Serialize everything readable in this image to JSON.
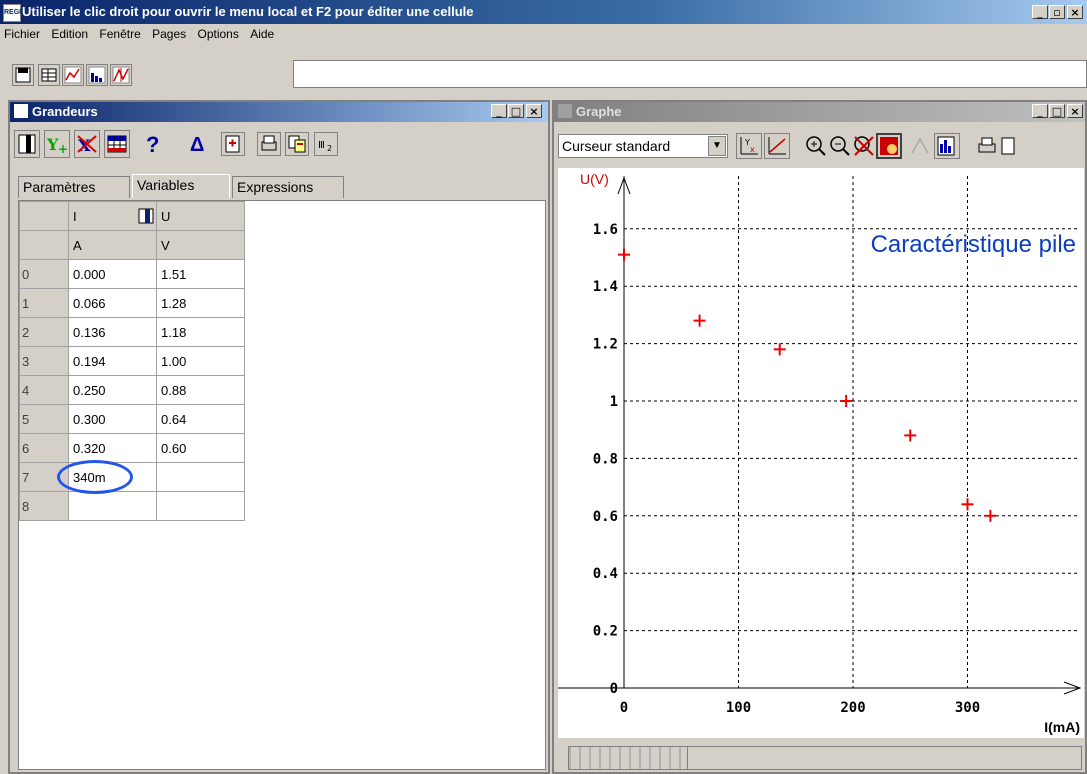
{
  "window": {
    "title": "Utiliser le clic droit pour ouvrir le menu local et F2 pour éditer une cellule",
    "app_icon_text": "REGR",
    "controls": [
      "_",
      "▫",
      "×"
    ]
  },
  "menu": [
    "Fichier",
    "Edition",
    "Fenêtre",
    "Pages",
    "Options",
    "Aide"
  ],
  "grandeurs": {
    "title": "Grandeurs",
    "tabs": [
      "Paramètres",
      "Variables",
      "Expressions"
    ],
    "active_tab": "Variables",
    "help_label": "?",
    "delta_label": "Δ",
    "columns": [
      {
        "name": "I",
        "unit": "A"
      },
      {
        "name": "U",
        "unit": "V"
      }
    ],
    "rows": [
      {
        "idx": "0",
        "I": "0.000",
        "U": "1.51"
      },
      {
        "idx": "1",
        "I": "0.066",
        "U": "1.28"
      },
      {
        "idx": "2",
        "I": "0.136",
        "U": "1.18"
      },
      {
        "idx": "3",
        "I": "0.194",
        "U": "1.00"
      },
      {
        "idx": "4",
        "I": "0.250",
        "U": "0.88"
      },
      {
        "idx": "5",
        "I": "0.300",
        "U": "0.64"
      },
      {
        "idx": "6",
        "I": "0.320",
        "U": "0.60"
      },
      {
        "idx": "7",
        "I": "340m",
        "U": ""
      },
      {
        "idx": "8",
        "I": "",
        "U": ""
      }
    ],
    "highlight_color": "#2255ee"
  },
  "graphe": {
    "title": "Graphe",
    "cursor_select": "Curseur standard",
    "x_unit_label": "I(mA)"
  },
  "chart_data": {
    "type": "scatter",
    "title": "Caractéristique pile",
    "xlabel": "I(mA)",
    "ylabel": "U(V)",
    "xlim": [
      0,
      380
    ],
    "ylim": [
      0,
      1.7
    ],
    "x_ticks": [
      0,
      100,
      200,
      300
    ],
    "y_ticks": [
      0,
      0.2,
      0.4,
      0.6,
      0.8,
      1,
      1.2,
      1.4,
      1.6
    ],
    "grid": true,
    "marker_color": "#ee0000",
    "title_color": "#0b3fbf",
    "points": [
      {
        "x": 0,
        "y": 1.51
      },
      {
        "x": 66,
        "y": 1.28
      },
      {
        "x": 136,
        "y": 1.18
      },
      {
        "x": 194,
        "y": 1.0
      },
      {
        "x": 250,
        "y": 0.88
      },
      {
        "x": 300,
        "y": 0.64
      },
      {
        "x": 320,
        "y": 0.6
      }
    ]
  }
}
